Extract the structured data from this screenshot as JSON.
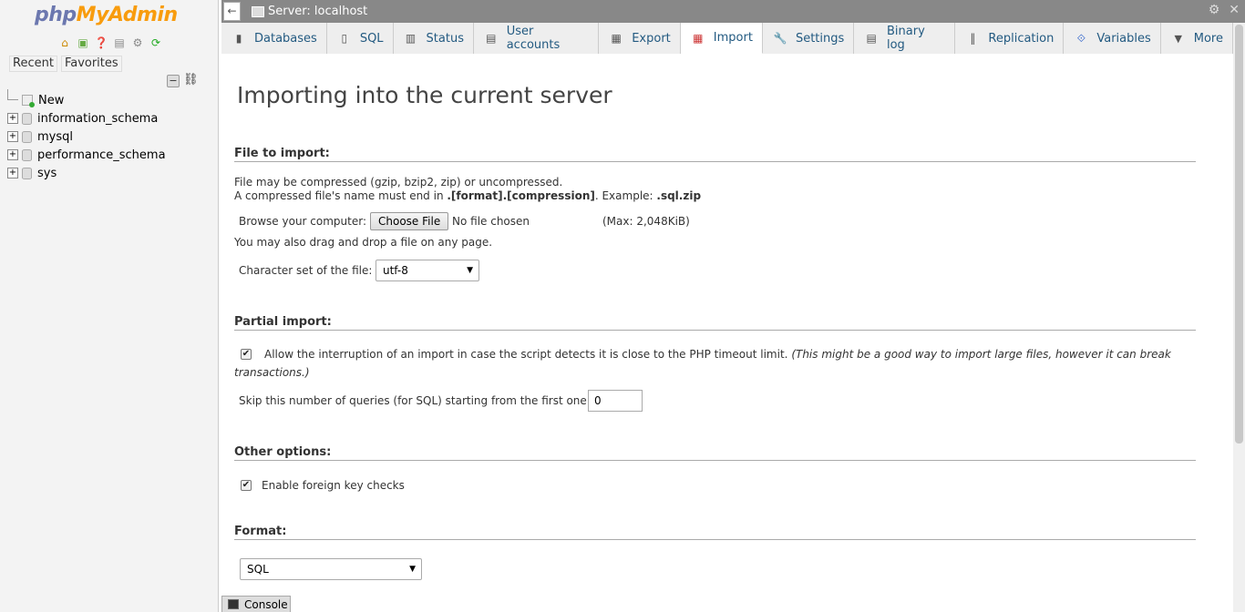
{
  "sidebar": {
    "logo": {
      "php": "php",
      "my": "My",
      "admin": "Admin"
    },
    "nav_icons": [
      "home-icon",
      "exit-icon",
      "help-icon",
      "docs-icon",
      "settings-icon",
      "reload-icon"
    ],
    "recent_label": "Recent",
    "favorites_label": "Favorites",
    "tree": [
      {
        "label": "New",
        "type": "new"
      },
      {
        "label": "information_schema",
        "type": "db"
      },
      {
        "label": "mysql",
        "type": "db"
      },
      {
        "label": "performance_schema",
        "type": "db"
      },
      {
        "label": "sys",
        "type": "db"
      }
    ]
  },
  "topbar": {
    "back_glyph": "←",
    "title": "Server: localhost"
  },
  "tabs": [
    {
      "label": "Databases",
      "icon": "database-icon"
    },
    {
      "label": "SQL",
      "icon": "sql-icon"
    },
    {
      "label": "Status",
      "icon": "status-icon"
    },
    {
      "label": "User accounts",
      "icon": "users-icon"
    },
    {
      "label": "Export",
      "icon": "export-icon"
    },
    {
      "label": "Import",
      "icon": "import-icon",
      "active": true
    },
    {
      "label": "Settings",
      "icon": "wrench-icon"
    },
    {
      "label": "Binary log",
      "icon": "binlog-icon"
    },
    {
      "label": "Replication",
      "icon": "replication-icon"
    },
    {
      "label": "Variables",
      "icon": "variables-icon"
    },
    {
      "label": "More",
      "icon": "more-icon"
    }
  ],
  "main": {
    "page_title": "Importing into the current server",
    "file_section": {
      "heading": "File to import:",
      "line1": "File may be compressed (gzip, bzip2, zip) or uncompressed.",
      "line2_prefix": "A compressed file's name must end in ",
      "line2_bold": ".[format].[compression]",
      "line2_mid": ". Example: ",
      "line2_example": ".sql.zip",
      "browse_label": "Browse your computer:",
      "choose_button": "Choose File",
      "no_file": "No file chosen",
      "max_size": "(Max: 2,048KiB)",
      "drag_text": "You may also drag and drop a file on any page.",
      "charset_label": "Character set of the file:",
      "charset_value": "utf-8"
    },
    "partial_section": {
      "heading": "Partial import:",
      "allow_checked": true,
      "allow_text": "Allow the interruption of an import in case the script detects it is close to the PHP timeout limit.",
      "allow_note_1": "(This might be a good way to import large files, however it can break",
      "allow_note_2": "transactions.)",
      "skip_label": "Skip this number of queries (for SQL) starting from the first one:",
      "skip_value": "0"
    },
    "other_section": {
      "heading": "Other options:",
      "fk_checked": true,
      "fk_label": "Enable foreign key checks"
    },
    "format_section": {
      "heading": "Format:",
      "format_value": "SQL"
    }
  },
  "console": {
    "label": "Console"
  }
}
